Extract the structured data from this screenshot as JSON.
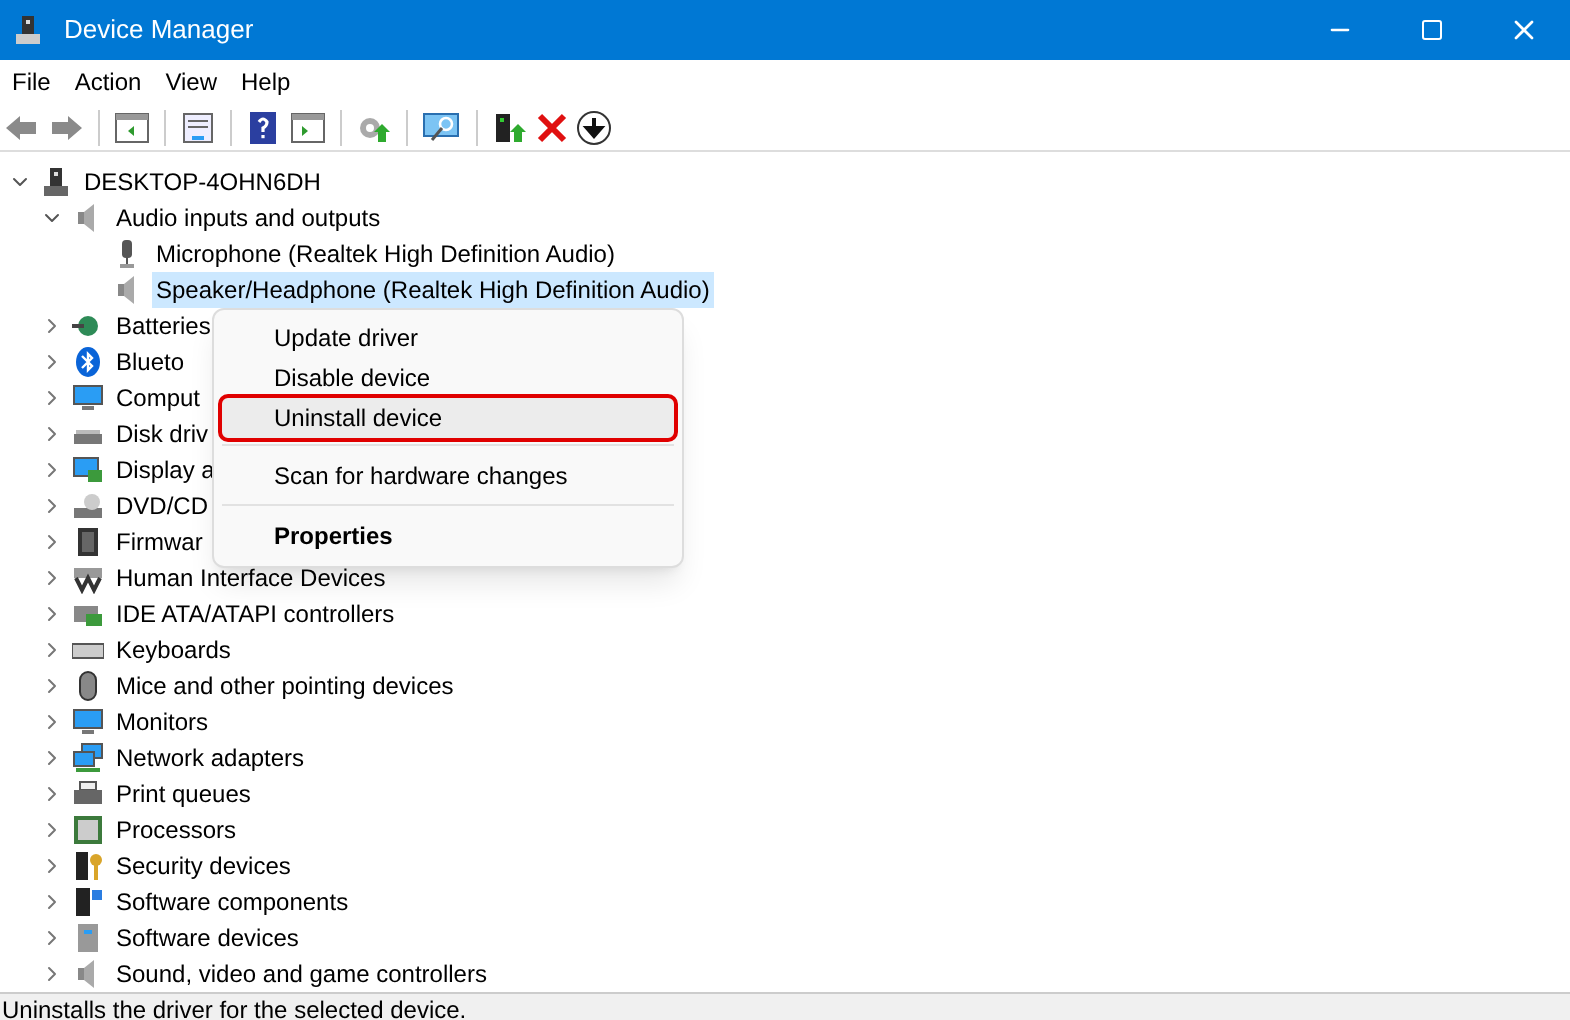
{
  "window": {
    "title": "Device Manager"
  },
  "menu_bar": [
    "File",
    "Action",
    "View",
    "Help"
  ],
  "tree": {
    "label": "DESKTOP-4OHN6DH",
    "expanded": true,
    "selected": false,
    "children": [
      {
        "label": "Audio inputs and outputs",
        "expanded": true,
        "selected": false,
        "children": [
          {
            "label": "Microphone (Realtek High Definition Audio)",
            "selected": false
          },
          {
            "label": "Speaker/Headphone (Realtek High Definition Audio)",
            "selected": true
          }
        ]
      },
      {
        "label": "Batteries",
        "expanded": false,
        "selected": false
      },
      {
        "label": "Blueto",
        "expanded": false,
        "selected": false
      },
      {
        "label": "Comput",
        "expanded": false,
        "selected": false
      },
      {
        "label": "Disk driv",
        "expanded": false,
        "selected": false
      },
      {
        "label": "Display a",
        "expanded": false,
        "selected": false
      },
      {
        "label": "DVD/CD",
        "expanded": false,
        "selected": false
      },
      {
        "label": "Firmwar",
        "expanded": false,
        "selected": false
      },
      {
        "label": "Human Interface Devices",
        "expanded": false,
        "selected": false
      },
      {
        "label": "IDE ATA/ATAPI controllers",
        "expanded": false,
        "selected": false
      },
      {
        "label": "Keyboards",
        "expanded": false,
        "selected": false
      },
      {
        "label": "Mice and other pointing devices",
        "expanded": false,
        "selected": false
      },
      {
        "label": "Monitors",
        "expanded": false,
        "selected": false
      },
      {
        "label": "Network adapters",
        "expanded": false,
        "selected": false
      },
      {
        "label": "Print queues",
        "expanded": false,
        "selected": false
      },
      {
        "label": "Processors",
        "expanded": false,
        "selected": false
      },
      {
        "label": "Security devices",
        "expanded": false,
        "selected": false
      },
      {
        "label": "Software components",
        "expanded": false,
        "selected": false
      },
      {
        "label": "Software devices",
        "expanded": false,
        "selected": false
      },
      {
        "label": "Sound, video and game controllers",
        "expanded": false,
        "selected": false
      }
    ]
  },
  "context_menu": [
    {
      "label": "Update driver",
      "highlighted": false,
      "bold": false,
      "divider_before": false
    },
    {
      "label": "Disable device",
      "highlighted": false,
      "bold": false,
      "divider_before": false
    },
    {
      "label": "Uninstall device",
      "highlighted": true,
      "bold": false,
      "divider_before": false
    },
    {
      "label": "Scan for hardware changes",
      "highlighted": false,
      "bold": false,
      "divider_before": true
    },
    {
      "label": "Properties",
      "highlighted": false,
      "bold": true,
      "divider_before": true
    }
  ],
  "status_bar": "Uninstalls the driver for the selected device."
}
